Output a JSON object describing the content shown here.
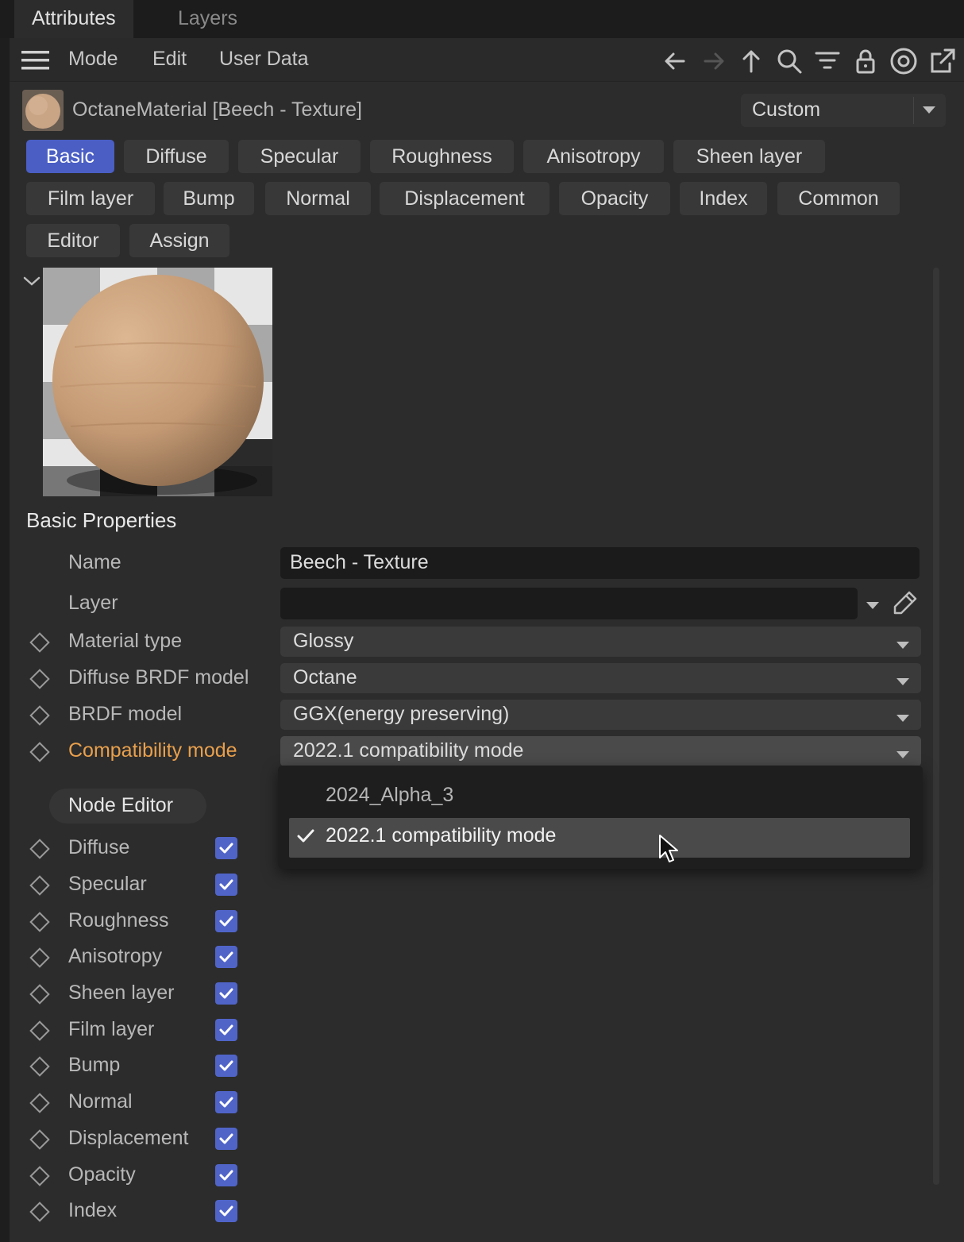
{
  "window_tabs": [
    "Attributes",
    "Layers"
  ],
  "menu": [
    "Mode",
    "Edit",
    "User Data"
  ],
  "toolbar_icons": [
    "back-arrow-icon",
    "forward-arrow-icon",
    "up-arrow-icon",
    "search-icon",
    "filter-icon",
    "lock-icon",
    "target-icon",
    "new-window-icon"
  ],
  "object": {
    "title": "OctaneMaterial [Beech - Texture]",
    "preset": "Custom"
  },
  "tabs": [
    "Basic",
    "Diffuse",
    "Specular",
    "Roughness",
    "Anisotropy",
    "Sheen layer",
    "Film layer",
    "Bump",
    "Normal",
    "Displacement",
    "Opacity",
    "Index",
    "Common",
    "Editor",
    "Assign"
  ],
  "active_tab": "Basic",
  "section_title": "Basic Properties",
  "fields": {
    "name_label": "Name",
    "name_value": "Beech - Texture",
    "layer_label": "Layer",
    "layer_value": "",
    "material_type_label": "Material type",
    "material_type_value": "Glossy",
    "diffuse_brdf_label": "Diffuse BRDF model",
    "diffuse_brdf_value": "Octane",
    "brdf_label": "BRDF model",
    "brdf_value": "GGX(energy preserving)",
    "compat_label": "Compatibility mode",
    "compat_value": "2022.1 compatibility mode"
  },
  "compat_options": [
    "2024_Alpha_3",
    "2022.1 compatibility mode"
  ],
  "compat_selected": "2022.1 compatibility mode",
  "node_editor_label": "Node Editor",
  "channels": [
    {
      "label": "Diffuse",
      "checked": true
    },
    {
      "label": "Specular",
      "checked": true
    },
    {
      "label": "Roughness",
      "checked": true
    },
    {
      "label": "Anisotropy",
      "checked": true
    },
    {
      "label": "Sheen layer",
      "checked": true
    },
    {
      "label": "Film layer",
      "checked": true
    },
    {
      "label": "Bump",
      "checked": true
    },
    {
      "label": "Normal",
      "checked": true
    },
    {
      "label": "Displacement",
      "checked": true
    },
    {
      "label": "Opacity",
      "checked": true
    },
    {
      "label": "Index",
      "checked": true
    }
  ],
  "colors": {
    "accent": "#4a5ec4",
    "highlight": "#e9a04c",
    "checkbox": "#5064c8"
  }
}
